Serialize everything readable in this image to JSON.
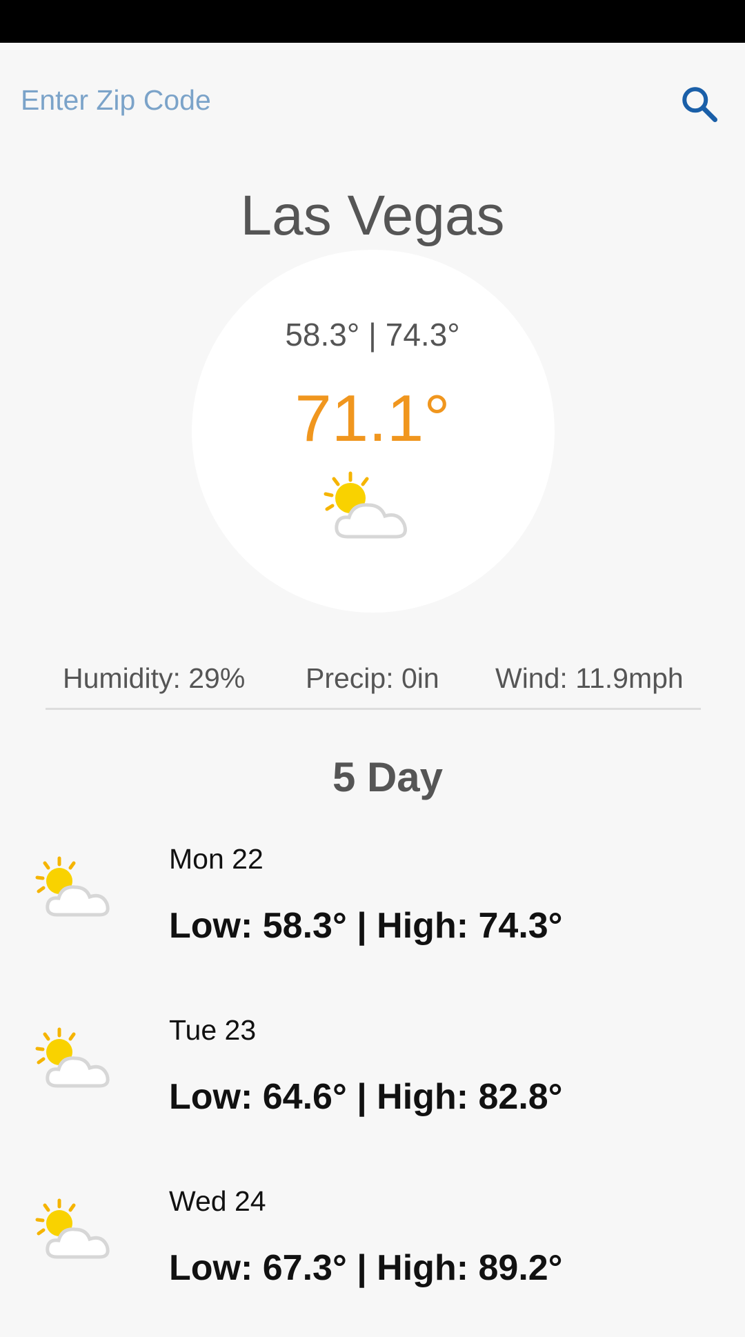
{
  "search": {
    "placeholder": "Enter Zip Code",
    "icon": "search-icon"
  },
  "current": {
    "city": "Las Vegas",
    "hilo": "58.3° | 74.3°",
    "temp": "71.1°",
    "icon": "partly-cloudy-icon"
  },
  "stats": {
    "humidity": "Humidity: 29%",
    "precip": "Precip: 0in",
    "wind": "Wind: 11.9mph"
  },
  "forecast": {
    "title": "5 Day",
    "days": [
      {
        "day": "Mon 22",
        "temps": "Low: 58.3° | High: 74.3°",
        "icon": "partly-cloudy-icon"
      },
      {
        "day": "Tue 23",
        "temps": "Low: 64.6° | High: 82.8°",
        "icon": "partly-cloudy-icon"
      },
      {
        "day": "Wed 24",
        "temps": "Low: 67.3° | High: 89.2°",
        "icon": "partly-cloudy-icon"
      }
    ]
  },
  "colors": {
    "accent": "#f0961e",
    "search_icon": "#1a5fa8",
    "placeholder": "#7ba3c9",
    "text": "#555555"
  }
}
